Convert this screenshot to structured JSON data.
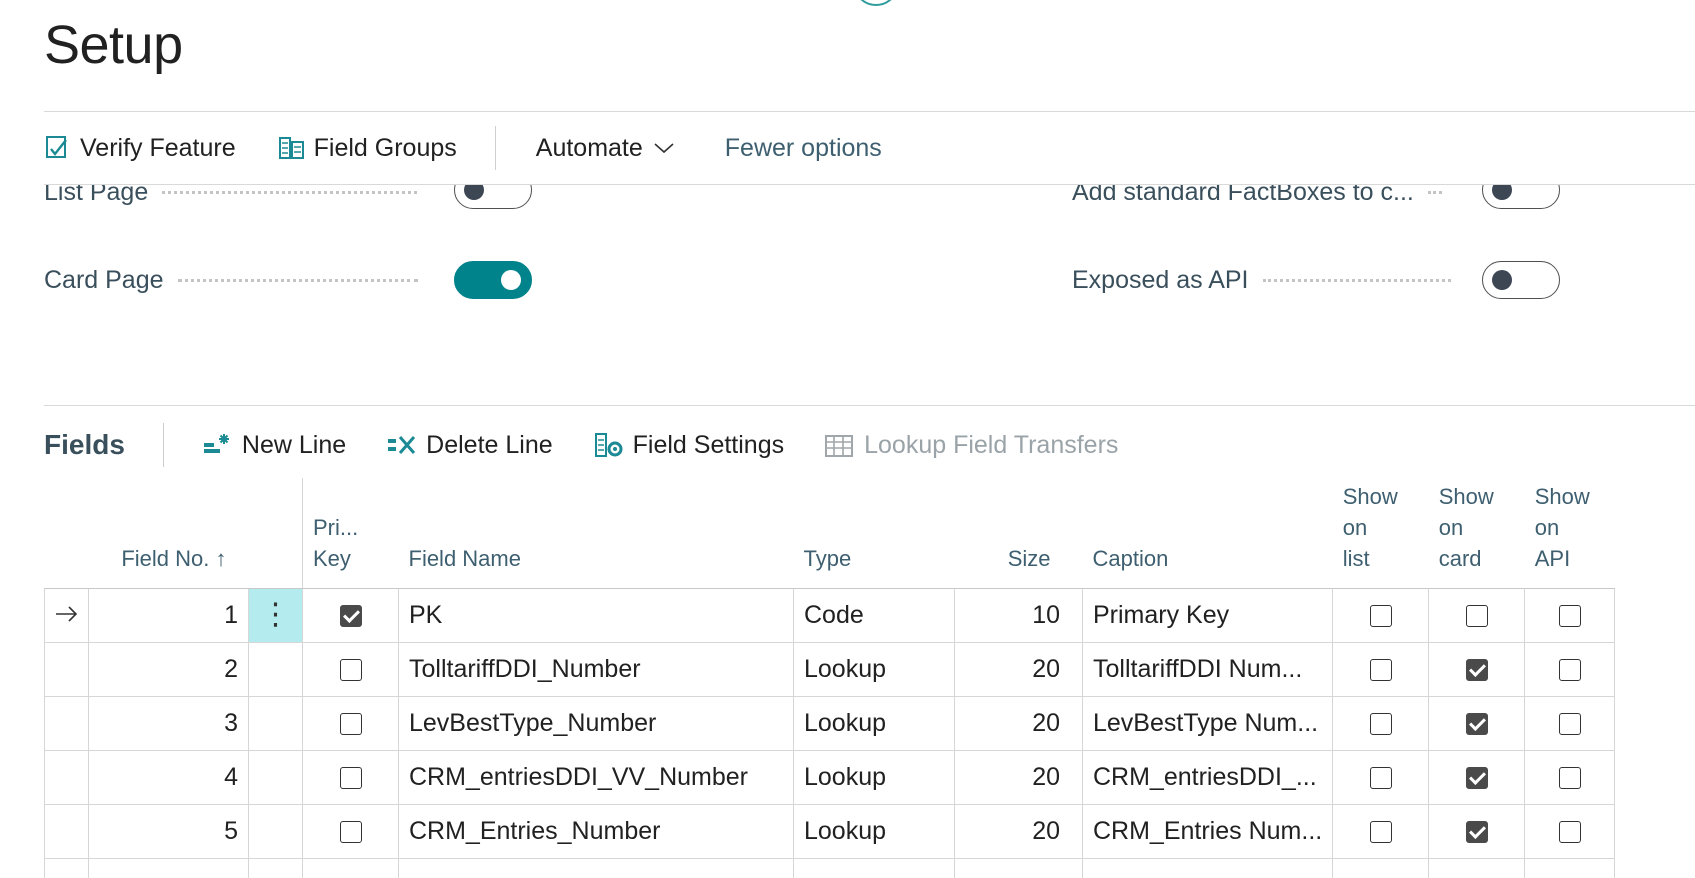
{
  "page": {
    "title": "Setup"
  },
  "toolbar": {
    "verify_feature": "Verify Feature",
    "field_groups": "Field Groups",
    "automate": "Automate",
    "fewer_options": "Fewer options"
  },
  "general": {
    "list_page_label": "List Page",
    "list_page_on": false,
    "card_page_label": "Card Page",
    "card_page_on": true,
    "factboxes_label": "Add standard FactBoxes to c...",
    "factboxes_on": false,
    "exposed_api_label": "Exposed as API",
    "exposed_api_on": false
  },
  "fields": {
    "title": "Fields",
    "new_line": "New Line",
    "delete_line": "Delete Line",
    "field_settings": "Field Settings",
    "lookup_field_transfers": "Lookup Field Transfers",
    "columns": {
      "field_no": "Field No.",
      "sort_arrow": "↑",
      "pri_key_1": "Pri...",
      "pri_key_2": "Key",
      "field_name": "Field Name",
      "type": "Type",
      "size": "Size",
      "caption": "Caption",
      "show_on_list_1": "Show",
      "show_on_list_2": "on",
      "show_on_list_3": "list",
      "show_on_card_1": "Show",
      "show_on_card_2": "on",
      "show_on_card_3": "card",
      "show_on_api_1": "Show",
      "show_on_api_2": "on",
      "show_on_api_3": "API"
    },
    "rows": [
      {
        "no": "1",
        "pk": true,
        "name": "PK",
        "type": "Code",
        "size": "10",
        "caption": "Primary Key",
        "list": false,
        "card": false,
        "api": false,
        "current": true
      },
      {
        "no": "2",
        "pk": false,
        "name": "TolltariffDDI_Number",
        "type": "Lookup",
        "size": "20",
        "caption": "TolltariffDDI Num...",
        "list": false,
        "card": true,
        "api": false,
        "current": false
      },
      {
        "no": "3",
        "pk": false,
        "name": "LevBestType_Number",
        "type": "Lookup",
        "size": "20",
        "caption": "LevBestType Num...",
        "list": false,
        "card": true,
        "api": false,
        "current": false
      },
      {
        "no": "4",
        "pk": false,
        "name": "CRM_entriesDDI_VV_Number",
        "type": "Lookup",
        "size": "20",
        "caption": "CRM_entriesDDI_...",
        "list": false,
        "card": true,
        "api": false,
        "current": false
      },
      {
        "no": "5",
        "pk": false,
        "name": "CRM_Entries_Number",
        "type": "Lookup",
        "size": "20",
        "caption": "CRM_Entries Num...",
        "list": false,
        "card": true,
        "api": false,
        "current": false
      }
    ]
  },
  "icons": {
    "verify": "verify-feature-icon",
    "groups": "field-groups-icon",
    "new_line": "new-line-icon",
    "delete_line": "delete-line-icon",
    "settings": "field-settings-icon",
    "lookup": "lookup-field-transfers-icon",
    "current_row": "current-row-arrow-icon",
    "row_menu": "row-actions-icon"
  },
  "colors": {
    "accent": "#00838a",
    "row_highlight": "#b4ebee"
  }
}
